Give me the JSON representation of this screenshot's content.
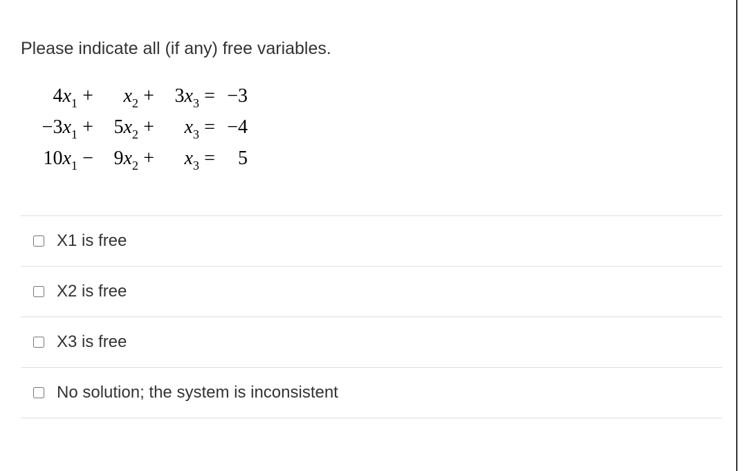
{
  "question": "Please indicate all (if any) free variables.",
  "equations": {
    "row1": {
      "a": "4",
      "op1": "+",
      "b": "",
      "op2": "+",
      "c": "3",
      "rhs": "−3"
    },
    "row2": {
      "a": "−3",
      "op1": "+",
      "b": "5",
      "op2": "+",
      "c": "",
      "rhs": "−4"
    },
    "row3": {
      "a": "10",
      "op1": "−",
      "b": "9",
      "op2": "+",
      "c": "",
      "rhs": "5"
    }
  },
  "options": [
    {
      "label": "X1 is free"
    },
    {
      "label": "X2 is free"
    },
    {
      "label": "X3 is free"
    },
    {
      "label": "No solution; the system is inconsistent"
    }
  ]
}
